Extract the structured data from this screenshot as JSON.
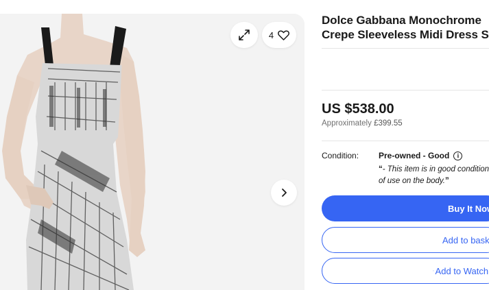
{
  "gallery": {
    "watch_count": "4",
    "icons": {
      "expand": "expand-icon",
      "heart": "heart-icon",
      "next": "chevron-right-icon"
    }
  },
  "listing": {
    "title_line1": "Dolce Gabbana Monochrome",
    "title_line2": "Crepe Sleeveless Midi Dress S"
  },
  "pricing": {
    "price": "US $538.00",
    "approx_label": "Approximately",
    "approx_value": "£399.55"
  },
  "condition": {
    "label": "Condition:",
    "value": "Pre-owned - Good",
    "description_line1": "This item is in good condition",
    "description_line2": "of use on the body."
  },
  "actions": {
    "buy_now": "Buy It Now",
    "add_basket": "Add to basket",
    "add_watchlist": "Add to Watchlist"
  },
  "colors": {
    "accent": "#3665f3",
    "text": "#191919",
    "muted": "#707070"
  }
}
